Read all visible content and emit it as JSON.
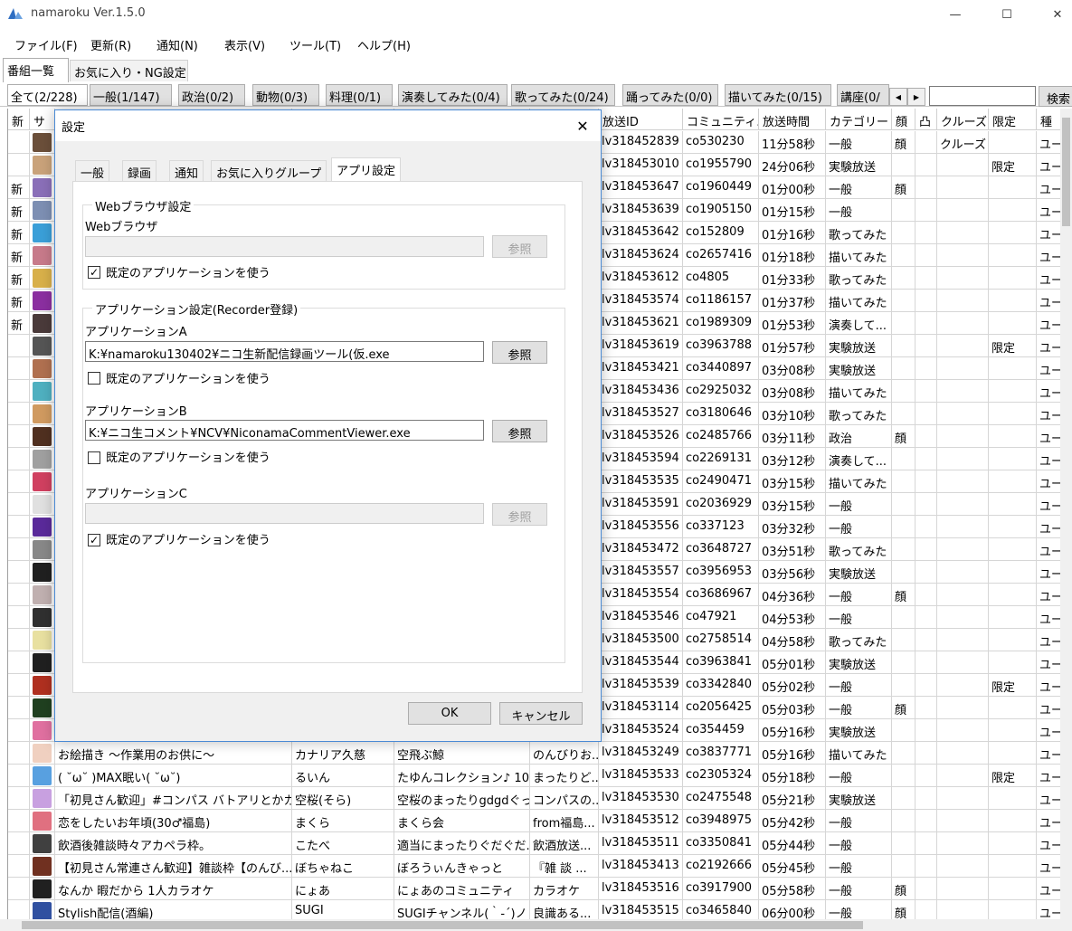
{
  "window": {
    "title": "namaroku Ver.1.5.0",
    "minimize_glyph": "—",
    "maximize_glyph": "☐",
    "close_glyph": "✕"
  },
  "menu": [
    "ファイル(F)",
    "更新(R)",
    "通知(N)",
    "表示(V)",
    "ツール(T)",
    "ヘルプ(H)"
  ],
  "main_tabs": [
    "番組一覧",
    "お気に入り・NG設定"
  ],
  "category_tabs": [
    "全て(2/228)",
    "一般(1/147)",
    "政治(0/2)",
    "動物(0/3)",
    "料理(0/1)",
    "演奏してみた(0/4)",
    "歌ってみた(0/24)",
    "踊ってみた(0/0)",
    "描いてみた(0/15)",
    "講座(0/"
  ],
  "search": {
    "value": "",
    "button_label": "検索"
  },
  "table": {
    "headers": [
      "新",
      "サ",
      "",
      "",
      "",
      "",
      "放送ID",
      "コミュニティ...",
      "放送時間",
      "カテゴリー",
      "顔",
      "凸",
      "クルーズ",
      "限定",
      "種"
    ],
    "rows": [
      {
        "new": "",
        "title": "",
        "user": "",
        "community": "",
        "desc": "",
        "id": "lv318452839",
        "co": "co530230",
        "time": "11分58秒",
        "cat": "一般",
        "face": "顔",
        "cruise": "クルーズ",
        "limited": "",
        "kind": "ユー"
      },
      {
        "new": "",
        "title": "",
        "user": "",
        "community": "",
        "desc": "",
        "id": "lv318453010",
        "co": "co1955790",
        "time": "24分06秒",
        "cat": "実験放送",
        "face": "",
        "cruise": "",
        "limited": "限定",
        "kind": "ユー"
      },
      {
        "new": "新",
        "title": "",
        "user": "",
        "community": "",
        "desc": "",
        "id": "lv318453647",
        "co": "co1960449",
        "time": "01分00秒",
        "cat": "一般",
        "face": "顔",
        "cruise": "",
        "limited": "",
        "kind": "ユー"
      },
      {
        "new": "新",
        "title": "",
        "user": "",
        "community": "",
        "desc": "",
        "id": "lv318453639",
        "co": "co1905150",
        "time": "01分15秒",
        "cat": "一般",
        "face": "",
        "cruise": "",
        "limited": "",
        "kind": "ユー"
      },
      {
        "new": "新",
        "title": "",
        "user": "",
        "community": "",
        "desc": "",
        "id": "lv318453642",
        "co": "co152809",
        "time": "01分16秒",
        "cat": "歌ってみた",
        "face": "",
        "cruise": "",
        "limited": "",
        "kind": "ユー"
      },
      {
        "new": "新",
        "title": "",
        "user": "",
        "community": "",
        "desc": "",
        "id": "lv318453624",
        "co": "co2657416",
        "time": "01分18秒",
        "cat": "描いてみた",
        "face": "",
        "cruise": "",
        "limited": "",
        "kind": "ユー"
      },
      {
        "new": "新",
        "title": "",
        "user": "",
        "community": "",
        "desc": "",
        "id": "lv318453612",
        "co": "co4805",
        "time": "01分33秒",
        "cat": "歌ってみた",
        "face": "",
        "cruise": "",
        "limited": "",
        "kind": "ユー"
      },
      {
        "new": "新",
        "title": "",
        "user": "",
        "community": "",
        "desc": "",
        "id": "lv318453574",
        "co": "co1186157",
        "time": "01分37秒",
        "cat": "描いてみた",
        "face": "",
        "cruise": "",
        "limited": "",
        "kind": "ユー"
      },
      {
        "new": "新",
        "title": "",
        "user": "",
        "community": "",
        "desc": "",
        "id": "lv318453621",
        "co": "co1989309",
        "time": "01分53秒",
        "cat": "演奏して...",
        "face": "",
        "cruise": "",
        "limited": "",
        "kind": "ユー"
      },
      {
        "new": "",
        "title": "",
        "user": "",
        "community": "",
        "desc": "",
        "id": "lv318453619",
        "co": "co3963788",
        "time": "01分57秒",
        "cat": "実験放送",
        "face": "",
        "cruise": "",
        "limited": "限定",
        "kind": "ユー"
      },
      {
        "new": "",
        "title": "",
        "user": "",
        "community": "",
        "desc": "",
        "id": "lv318453421",
        "co": "co3440897",
        "time": "03分08秒",
        "cat": "実験放送",
        "face": "",
        "cruise": "",
        "limited": "",
        "kind": "ユー"
      },
      {
        "new": "",
        "title": "",
        "user": "",
        "community": "",
        "desc": "",
        "id": "lv318453436",
        "co": "co2925032",
        "time": "03分08秒",
        "cat": "描いてみた",
        "face": "",
        "cruise": "",
        "limited": "",
        "kind": "ユー"
      },
      {
        "new": "",
        "title": "",
        "user": "",
        "community": "",
        "desc": "",
        "id": "lv318453527",
        "co": "co3180646",
        "time": "03分10秒",
        "cat": "歌ってみた",
        "face": "",
        "cruise": "",
        "limited": "",
        "kind": "ユー"
      },
      {
        "new": "",
        "title": "",
        "user": "",
        "community": "",
        "desc": "",
        "id": "lv318453526",
        "co": "co2485766",
        "time": "03分11秒",
        "cat": "政治",
        "face": "顔",
        "cruise": "",
        "limited": "",
        "kind": "ユー"
      },
      {
        "new": "",
        "title": "",
        "user": "",
        "community": "",
        "desc": "",
        "id": "lv318453594",
        "co": "co2269131",
        "time": "03分12秒",
        "cat": "演奏して...",
        "face": "",
        "cruise": "",
        "limited": "",
        "kind": "ユー"
      },
      {
        "new": "",
        "title": "",
        "user": "",
        "community": "",
        "desc": "",
        "id": "lv318453535",
        "co": "co2490471",
        "time": "03分15秒",
        "cat": "描いてみた",
        "face": "",
        "cruise": "",
        "limited": "",
        "kind": "ユー"
      },
      {
        "new": "",
        "title": "",
        "user": "",
        "community": "",
        "desc": "",
        "id": "lv318453591",
        "co": "co2036929",
        "time": "03分15秒",
        "cat": "一般",
        "face": "",
        "cruise": "",
        "limited": "",
        "kind": "ユー"
      },
      {
        "new": "",
        "title": "",
        "user": "",
        "community": "",
        "desc": "",
        "id": "lv318453556",
        "co": "co337123",
        "time": "03分32秒",
        "cat": "一般",
        "face": "",
        "cruise": "",
        "limited": "",
        "kind": "ユー"
      },
      {
        "new": "",
        "title": "",
        "user": "",
        "community": "",
        "desc": "",
        "id": "lv318453472",
        "co": "co3648727",
        "time": "03分51秒",
        "cat": "歌ってみた",
        "face": "",
        "cruise": "",
        "limited": "",
        "kind": "ユー"
      },
      {
        "new": "",
        "title": "",
        "user": "",
        "community": "",
        "desc": "",
        "id": "lv318453557",
        "co": "co3956953",
        "time": "03分56秒",
        "cat": "実験放送",
        "face": "",
        "cruise": "",
        "limited": "",
        "kind": "ユー"
      },
      {
        "new": "",
        "title": "",
        "user": "",
        "community": "",
        "desc": "",
        "id": "lv318453554",
        "co": "co3686967",
        "time": "04分36秒",
        "cat": "一般",
        "face": "顔",
        "cruise": "",
        "limited": "",
        "kind": "ユー"
      },
      {
        "new": "",
        "title": "",
        "user": "",
        "community": "",
        "desc": "",
        "id": "lv318453546",
        "co": "co47921",
        "time": "04分53秒",
        "cat": "一般",
        "face": "",
        "cruise": "",
        "limited": "",
        "kind": "ユー"
      },
      {
        "new": "",
        "title": "",
        "user": "",
        "community": "",
        "desc": "",
        "id": "lv318453500",
        "co": "co2758514",
        "time": "04分58秒",
        "cat": "歌ってみた",
        "face": "",
        "cruise": "",
        "limited": "",
        "kind": "ユー"
      },
      {
        "new": "",
        "title": "",
        "user": "",
        "community": "",
        "desc": "",
        "id": "lv318453544",
        "co": "co3963841",
        "time": "05分01秒",
        "cat": "実験放送",
        "face": "",
        "cruise": "",
        "limited": "",
        "kind": "ユー"
      },
      {
        "new": "",
        "title": "",
        "user": "",
        "community": "",
        "desc": "",
        "id": "lv318453539",
        "co": "co3342840",
        "time": "05分02秒",
        "cat": "一般",
        "face": "",
        "cruise": "",
        "limited": "限定",
        "kind": "ユー"
      },
      {
        "new": "",
        "title": "",
        "user": "",
        "community": "",
        "desc": "",
        "id": "lv318453114",
        "co": "co2056425",
        "time": "05分03秒",
        "cat": "一般",
        "face": "顔",
        "cruise": "",
        "limited": "",
        "kind": "ユー"
      },
      {
        "new": "",
        "title": "",
        "user": "",
        "community": "",
        "desc": "",
        "id": "lv318453524",
        "co": "co354459",
        "time": "05分16秒",
        "cat": "実験放送",
        "face": "",
        "cruise": "",
        "limited": "",
        "kind": "ユー"
      },
      {
        "new": "",
        "title": "お絵描き ～作業用のお供に～",
        "user": "カナリア久慈",
        "community": "空飛ぶ鯨",
        "desc": "のんびりお...",
        "id": "lv318453249",
        "co": "co3837771",
        "time": "05分16秒",
        "cat": "描いてみた",
        "face": "",
        "cruise": "",
        "limited": "",
        "kind": "ユー"
      },
      {
        "new": "",
        "title": "( ˘ω˘ )MAX眠い( ˘ω˘)",
        "user": "るいん",
        "community": "たゆんコレクション♪ 10...",
        "desc": "まったりど...",
        "id": "lv318453533",
        "co": "co2305324",
        "time": "05分18秒",
        "cat": "一般",
        "face": "",
        "cruise": "",
        "limited": "限定",
        "kind": "ユー"
      },
      {
        "new": "",
        "title": "「初見さん歓迎」#コンパス バトアリとかカス...",
        "user": "空桜(そら)",
        "community": "空桜のまったりgdgdぐっ...",
        "desc": "コンパスの...",
        "id": "lv318453530",
        "co": "co2475548",
        "time": "05分21秒",
        "cat": "実験放送",
        "face": "",
        "cruise": "",
        "limited": "",
        "kind": "ユー"
      },
      {
        "new": "",
        "title": "恋をしたいお年頃(30♂福島)",
        "user": "まくら",
        "community": "まくら会",
        "desc": "from福島...",
        "id": "lv318453512",
        "co": "co3948975",
        "time": "05分42秒",
        "cat": "一般",
        "face": "",
        "cruise": "",
        "limited": "",
        "kind": "ユー"
      },
      {
        "new": "",
        "title": "飲酒後雑談時々アカペラ枠。",
        "user": "こたべ",
        "community": "適当にまったりぐだぐだ...",
        "desc": "飲酒放送...",
        "id": "lv318453511",
        "co": "co3350841",
        "time": "05分44秒",
        "cat": "一般",
        "face": "",
        "cruise": "",
        "limited": "",
        "kind": "ユー"
      },
      {
        "new": "",
        "title": "【初見さん常連さん歓迎】雑談枠【のんび...",
        "user": "ぼちゃねこ",
        "community": "ぼろうぃんきゃっと",
        "desc": "『雑 談 ...",
        "id": "lv318453413",
        "co": "co2192666",
        "time": "05分45秒",
        "cat": "一般",
        "face": "",
        "cruise": "",
        "limited": "",
        "kind": "ユー"
      },
      {
        "new": "",
        "title": "なんか 暇だから 1人カラオケ",
        "user": "にょあ",
        "community": "にょあのコミュニティ",
        "desc": "カラオケ",
        "id": "lv318453516",
        "co": "co3917900",
        "time": "05分58秒",
        "cat": "一般",
        "face": "顔",
        "cruise": "",
        "limited": "",
        "kind": "ユー"
      },
      {
        "new": "",
        "title": "Stylish配信(酒編)",
        "user": "SUGI",
        "community": "SUGIチャンネル(｀-´)ノ",
        "desc": "良識ある...",
        "id": "lv318453515",
        "co": "co3465840",
        "time": "06分00秒",
        "cat": "一般",
        "face": "顔",
        "cruise": "",
        "limited": "",
        "kind": "ユー"
      }
    ]
  },
  "dialog": {
    "title": "設定",
    "close_glyph": "✕",
    "tabs": [
      "一般",
      "録画",
      "通知",
      "お気に入りグループ",
      "アプリ設定"
    ],
    "web_group": {
      "legend": "Webブラウザ設定",
      "label": "Webブラウザ",
      "path": "",
      "browse": "参照",
      "default_label": "既定のアプリケーションを使う",
      "default_checked": "✓"
    },
    "app_group": {
      "legend": "アプリケーション設定(Recorder登録)",
      "apps": [
        {
          "label": "アプリケーションA",
          "path": "K:¥namaroku130402¥ニコ生新配信録画ツール(仮.exe",
          "browse": "参照",
          "default_label": "既定のアプリケーションを使う",
          "checked": ""
        },
        {
          "label": "アプリケーションB",
          "path": "K:¥ニコ生コメント¥NCV¥NiconamaCommentViewer.exe",
          "browse": "参照",
          "default_label": "既定のアプリケーションを使う",
          "checked": ""
        },
        {
          "label": "アプリケーションC",
          "path": "",
          "browse": "参照",
          "default_label": "既定のアプリケーションを使う",
          "checked": "✓"
        }
      ]
    },
    "ok": "OK",
    "cancel": "キャンセル"
  },
  "colors": {
    "dialog_border": "#4a8ad4",
    "app_icon": "#2f6ec2"
  }
}
